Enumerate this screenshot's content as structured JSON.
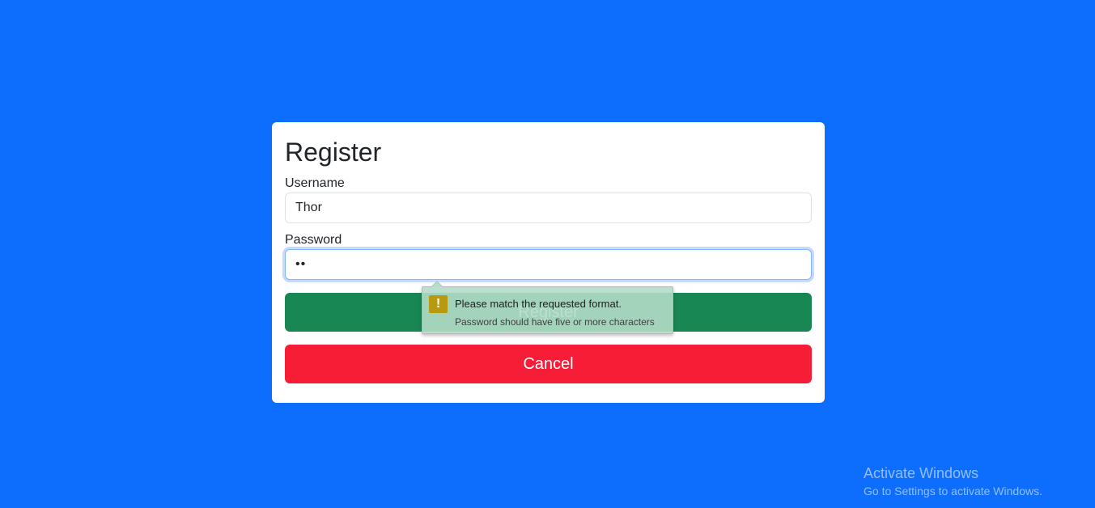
{
  "form": {
    "title": "Register",
    "username_label": "Username",
    "username_value": "Thor",
    "password_label": "Password",
    "password_value": "••",
    "register_label": "Register",
    "cancel_label": "Cancel"
  },
  "validation_tooltip": {
    "icon": "warning-icon",
    "icon_glyph": "!",
    "message": "Please match the requested format.",
    "detail": "Password should have five or more characters"
  },
  "watermark": {
    "title": "Activate Windows",
    "subtitle": "Go to Settings to activate Windows."
  },
  "colors": {
    "background": "#0d6efd",
    "register_button": "#198754",
    "cancel_button": "#f71d37",
    "focus_border": "#86b7fe"
  }
}
